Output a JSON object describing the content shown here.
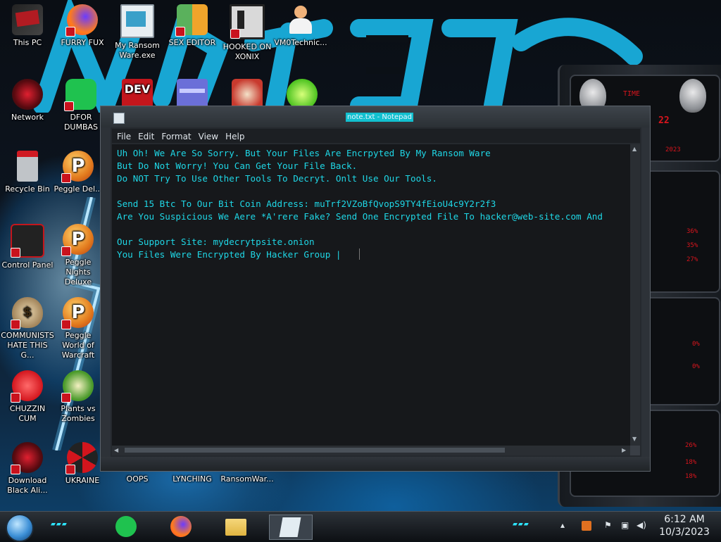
{
  "desktop": {
    "icons": [
      {
        "name": "this-pc",
        "label": "This PC",
        "icon": "computer-icon"
      },
      {
        "name": "furry-fux",
        "label": "FURRY FUX",
        "icon": "firefox-icon"
      },
      {
        "name": "my-ransom-ware",
        "label": "My Ransom Ware.exe",
        "icon": "window-icon"
      },
      {
        "name": "sex-editor",
        "label": "SEX EDITOR",
        "icon": "editor-icon"
      },
      {
        "name": "hooked-on-xonix",
        "label": "HOOKED ON XONIX",
        "icon": "game-icon"
      },
      {
        "name": "vm0technic",
        "label": "VM0Technic...",
        "icon": "person-icon"
      },
      {
        "name": "network",
        "label": "Network",
        "icon": "alien-globe-icon"
      },
      {
        "name": "dfor-dumbas",
        "label": "DFOR DUMBAS",
        "icon": "green-app-icon"
      },
      {
        "name": "dev-cpp",
        "label": "",
        "icon": "dev-cpp-icon"
      },
      {
        "name": "card-app",
        "label": "",
        "icon": "card-icon"
      },
      {
        "name": "santa-app",
        "label": "",
        "icon": "santa-icon"
      },
      {
        "name": "limewire",
        "label": "",
        "icon": "lime-icon"
      },
      {
        "name": "recycle-bin",
        "label": "Recycle Bin",
        "icon": "recycle-bin-icon"
      },
      {
        "name": "peggle-deluxe",
        "label": "Peggle Del...",
        "icon": "peggle-icon"
      },
      {
        "name": "control-panel",
        "label": "Control Panel",
        "icon": "control-panel-icon"
      },
      {
        "name": "peggle-nights",
        "label": "Peggle Nights Deluxe",
        "icon": "peggle-icon"
      },
      {
        "name": "communists",
        "label": "COMMUNISTS HATE THIS G...",
        "icon": "money-bag-icon"
      },
      {
        "name": "peggle-wow",
        "label": "Peggle World of Warcraft",
        "icon": "peggle-icon"
      },
      {
        "name": "chuzzin-cum",
        "label": "CHUZZIN CUM",
        "icon": "chuzzle-icon"
      },
      {
        "name": "plants-vs-zombies",
        "label": "Plants vs Zombies",
        "icon": "plant-icon"
      },
      {
        "name": "download-black",
        "label": "Download Black Ali...",
        "icon": "alien-globe-icon"
      },
      {
        "name": "ukraine",
        "label": "UKRAINE",
        "icon": "radiation-icon"
      },
      {
        "name": "oops",
        "label": "OOPS",
        "icon": "blank-icon"
      },
      {
        "name": "lynching",
        "label": "LYNCHING",
        "icon": "blank-icon"
      },
      {
        "name": "ransomware",
        "label": "RansomWar...",
        "icon": "blank-icon"
      }
    ]
  },
  "notepad": {
    "title": "note.txt - Notepad",
    "menu": [
      "File",
      "Edit",
      "Format",
      "View",
      "Help"
    ],
    "text": "Uh Oh! We Are So Sorry. But Your Files Are Encrpyted By My Ransom Ware\nBut Do Not Worry! You Can Get Your File Back.\nDo NOT Try To Use Other Tools To Decryt. Onlt Use Our Tools.\n\nSend 15 Btc To Our Bit Coin Address: muTrf2VZoBfQvopS9TY4fEioU4c9Y2r2f3\nAre You Suspicious We Aere *A'rere Fake? Send One Encrypted File To hacker@web-site.com And\n\nOur Support Site: mydecrytpsite.onion\nYou Files Were Encrypted By Hacker Group |"
  },
  "widget": {
    "labels": [
      "TIME",
      "22",
      "2023",
      "36%",
      "35%",
      "27%",
      "0%",
      "0%",
      "26%",
      "18%",
      "18%"
    ]
  },
  "taskbar": {
    "pinned": [
      "green-app-icon",
      "firefox-icon",
      "file-explorer-icon",
      "notepad-icon"
    ],
    "tray_icons": [
      "chevron-up-icon",
      "app-icon",
      "flag-icon",
      "network-icon",
      "volume-icon"
    ],
    "time": "6:12 AM",
    "date": "10/3/2023"
  },
  "colors": {
    "notepad_text": "#1fd7e6",
    "title_highlight": "#12c0cf",
    "widget_red": "#d8151d",
    "accent_cyan": "#2ee6ff"
  }
}
